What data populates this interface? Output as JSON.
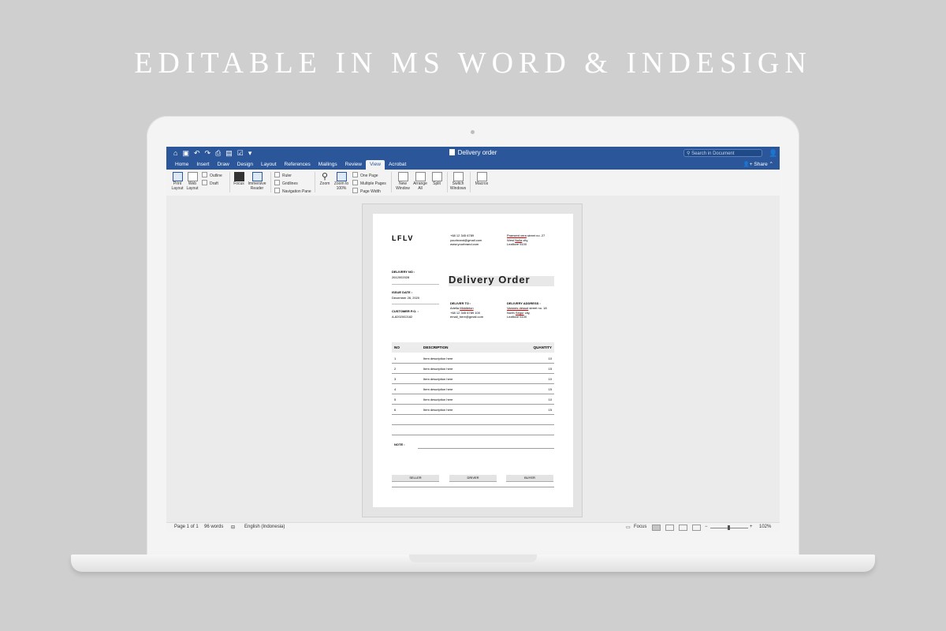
{
  "headline": "EDITABLE IN MS WORD & INDESIGN",
  "window": {
    "doc_title": "Delivery order",
    "search_placeholder": "Search in Document",
    "share_label": "Share",
    "quick_access": [
      "home-icon",
      "save-icon",
      "undo-icon",
      "redo-icon",
      "print-icon",
      "format-icon",
      "check-icon",
      "customize-icon"
    ]
  },
  "tabs": [
    "Home",
    "Insert",
    "Draw",
    "Design",
    "Layout",
    "References",
    "Mailings",
    "Review",
    "View",
    "Acrobat"
  ],
  "active_tab": "View",
  "ribbon": {
    "print_layout": "Print Layout",
    "web_layout": "Web Layout",
    "outline": "Outline",
    "draft": "Draft",
    "focus": "Focus",
    "immersive_reader": "Immersive Reader",
    "ruler": "Ruler",
    "gridlines": "Gridlines",
    "navigation_pane": "Navigation Pane",
    "zoom": "Zoom",
    "zoom_100": "Zoom to 100%",
    "one_page": "One Page",
    "multiple_pages": "Multiple Pages",
    "page_width": "Page Width",
    "new_window": "New Window",
    "arrange_all": "Arrange All",
    "split": "Split",
    "switch_windows": "Switch Windows",
    "macros": "Macros"
  },
  "document": {
    "brand": "LFLV",
    "contact": [
      "+68 12 345 6789",
      "yourbrand@gmail.com",
      "www.yourbrand.com"
    ],
    "address": {
      "line1_ul": "Praesent vera",
      "line1_rest": " street no. 27",
      "line2_a": "West ",
      "line2_ul": "Nulla",
      "line2_b": " city,",
      "line3": "Leaflove 5100"
    },
    "title": "Delivery Order",
    "delivery_no_label": "DELIVERY NO :",
    "delivery_no": "2612002028",
    "issue_date_label": "ISSUE DATE :",
    "issue_date": "December 28, 2020",
    "customer_po_label": "CUSTOMER P.O. :",
    "customer_po": "A-8202002182",
    "deliver_to_label": "DELIVER TO :",
    "deliver_to": {
      "a": "Ariella ",
      "ul": "Middleton",
      "phone": "+68 12 345 6789 100",
      "email": "email_here@gmail.com"
    },
    "delivery_address_label": "DELIVERY ADDRESS :",
    "delivery_address": {
      "ul1": "Vamnes dessot",
      "rest1": " street no. 18",
      "a": "North ",
      "ul2": "Segur",
      "b": " city,",
      "line3": "Leaflove 5100"
    },
    "table_headers": {
      "no": "NO",
      "description": "DESCRIPTION",
      "quantity": "QUANTITY"
    },
    "rows": [
      {
        "no": "1",
        "desc": "Item description here",
        "qty": "10"
      },
      {
        "no": "2",
        "desc": "Item description here",
        "qty": "15"
      },
      {
        "no": "3",
        "desc": "Item description here",
        "qty": "10"
      },
      {
        "no": "4",
        "desc": "Item description here",
        "qty": "15"
      },
      {
        "no": "5",
        "desc": "Item description here",
        "qty": "10"
      },
      {
        "no": "6",
        "desc": "Item description here",
        "qty": "15"
      }
    ],
    "note_label": "NOTE :",
    "seller": "SELLER",
    "driver": "DRIVER",
    "buyer": "BUYER"
  },
  "status": {
    "page": "Page 1 of 1",
    "words": "96 words",
    "language": "English (Indonesia)",
    "focus": "Focus",
    "zoom": "102%"
  }
}
